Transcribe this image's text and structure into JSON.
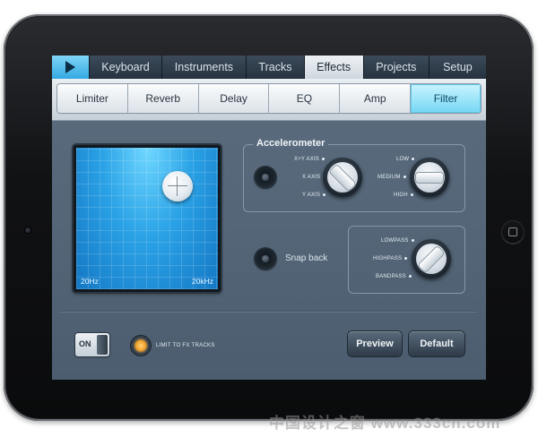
{
  "tabs": {
    "play_icon": "play-icon",
    "items": [
      {
        "label": "Keyboard",
        "active": false
      },
      {
        "label": "Instruments",
        "active": false
      },
      {
        "label": "Tracks",
        "active": false
      },
      {
        "label": "Effects",
        "active": true
      },
      {
        "label": "Projects",
        "active": false
      },
      {
        "label": "Setup",
        "active": false
      }
    ]
  },
  "effects": {
    "items": [
      {
        "label": "Limiter",
        "active": false
      },
      {
        "label": "Reverb",
        "active": false
      },
      {
        "label": "Delay",
        "active": false
      },
      {
        "label": "EQ",
        "active": false
      },
      {
        "label": "Amp",
        "active": false
      },
      {
        "label": "Filter",
        "active": true
      }
    ]
  },
  "xy_pad": {
    "min_label": "20Hz",
    "max_label": "20kHz"
  },
  "accelerometer": {
    "title": "Accelerometer",
    "axis_options": [
      "X+Y AXIS",
      "X AXIS",
      "Y AXIS"
    ],
    "level_options": [
      "LOW",
      "MEDIUM",
      "HIGH"
    ]
  },
  "filter": {
    "snap_back_label": "Snap back",
    "type_options": [
      "LOWPASS",
      "HIGHPASS",
      "BANDPASS"
    ]
  },
  "footer": {
    "on_label": "ON",
    "limit_label": "LIMIT TO FX TRACKS",
    "preview_label": "Preview",
    "default_label": "Default"
  },
  "watermark": "中国设计之窗 www.333cn.com",
  "colors": {
    "accent": "#5ec6ea",
    "panel": "#546678",
    "pad_blue": "#2aa2e6"
  }
}
